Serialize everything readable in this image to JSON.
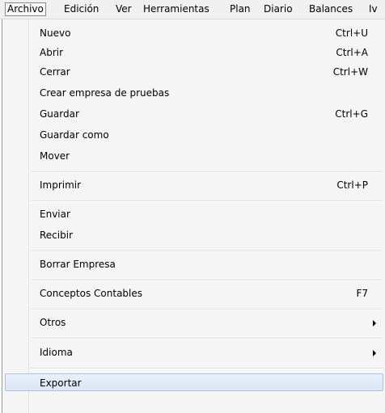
{
  "menubar": {
    "items": [
      {
        "label": "Archivo"
      },
      {
        "label": "Edición"
      },
      {
        "label": "Ver"
      },
      {
        "label": "Herramientas"
      },
      {
        "label": "Plan"
      },
      {
        "label": "Diario"
      },
      {
        "label": "Balances"
      },
      {
        "label": "Iv"
      }
    ]
  },
  "menu": {
    "items": [
      {
        "label": "Nuevo",
        "shortcut": "Ctrl+U"
      },
      {
        "label": "Abrir",
        "shortcut": "Ctrl+A"
      },
      {
        "label": "Cerrar",
        "shortcut": "Ctrl+W"
      },
      {
        "label": "Crear empresa de pruebas",
        "shortcut": ""
      },
      {
        "label": "Guardar",
        "shortcut": "Ctrl+G"
      },
      {
        "label": "Guardar como",
        "shortcut": ""
      },
      {
        "label": "Mover",
        "shortcut": ""
      },
      {
        "label": "Imprimir",
        "shortcut": "Ctrl+P"
      },
      {
        "label": "Enviar",
        "shortcut": ""
      },
      {
        "label": "Recibir",
        "shortcut": ""
      },
      {
        "label": "Borrar Empresa",
        "shortcut": ""
      },
      {
        "label": "Conceptos Contables",
        "shortcut": "F7"
      },
      {
        "label": "Otros",
        "shortcut": ""
      },
      {
        "label": "Idioma",
        "shortcut": ""
      },
      {
        "label": "Exportar",
        "shortcut": ""
      }
    ]
  },
  "icons": {
    "submenu_arrow": "chevron-right-icon"
  }
}
